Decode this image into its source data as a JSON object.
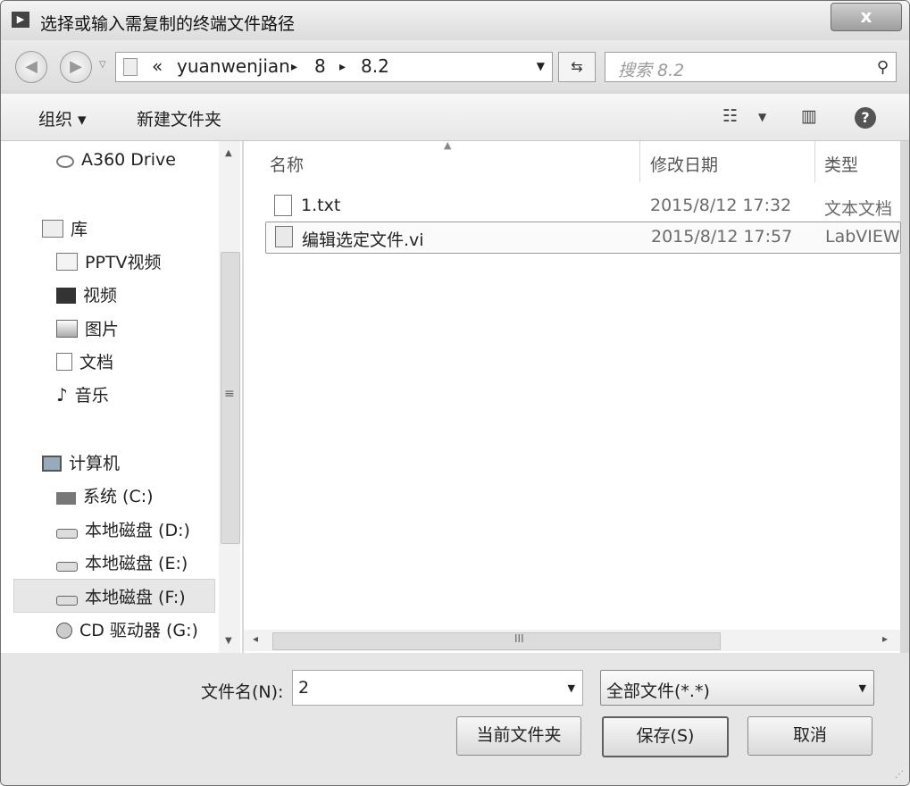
{
  "window": {
    "title": "选择或输入需复制的终端文件路径",
    "close_label": "x"
  },
  "address_bar": {
    "crumb_overflow": "«",
    "crumbs": [
      "yuanwenjian",
      "8",
      "8.2"
    ],
    "separator": "▸"
  },
  "search": {
    "placeholder": "搜索 8.2"
  },
  "toolbar": {
    "organize_label": "组织 ▾",
    "new_folder_label": "新建文件夹"
  },
  "sidebar": {
    "items": [
      {
        "label": "A360 Drive",
        "icon": "cloud-drive-icon"
      },
      {
        "label": "库",
        "icon": "library-icon"
      },
      {
        "label": "PPTV视频",
        "icon": "library-folder-icon"
      },
      {
        "label": "视频",
        "icon": "video-icon"
      },
      {
        "label": "图片",
        "icon": "pictures-icon"
      },
      {
        "label": "文档",
        "icon": "documents-icon"
      },
      {
        "label": "音乐",
        "icon": "music-icon"
      },
      {
        "label": "计算机",
        "icon": "computer-icon"
      },
      {
        "label": "系统 (C:)",
        "icon": "system-drive-icon"
      },
      {
        "label": "本地磁盘 (D:)",
        "icon": "hard-drive-icon"
      },
      {
        "label": "本地磁盘 (E:)",
        "icon": "hard-drive-icon"
      },
      {
        "label": "本地磁盘 (F:)",
        "icon": "hard-drive-icon"
      },
      {
        "label": "CD 驱动器 (G:)",
        "icon": "cd-drive-icon"
      }
    ],
    "selected_index": 11
  },
  "file_list": {
    "columns": [
      "名称",
      "修改日期",
      "类型"
    ],
    "rows": [
      {
        "name": "1.txt",
        "modified": "2015/8/12 17:32",
        "type": "文本文档",
        "icon": "text-file-icon"
      },
      {
        "name": "编辑选定文件.vi",
        "modified": "2015/8/12 17:57",
        "type": "LabVIEW",
        "icon": "vi-file-icon"
      }
    ],
    "selected_index": 1
  },
  "footer": {
    "filename_label": "文件名(N):",
    "filename_value": "2",
    "filetype_value": "全部文件(*.*)",
    "current_folder_label": "当前文件夹",
    "save_label": "保存(S)",
    "cancel_label": "取消"
  },
  "colors": {
    "selection_border": "#9a9a9a",
    "chrome_background": "#d9d9d9"
  }
}
